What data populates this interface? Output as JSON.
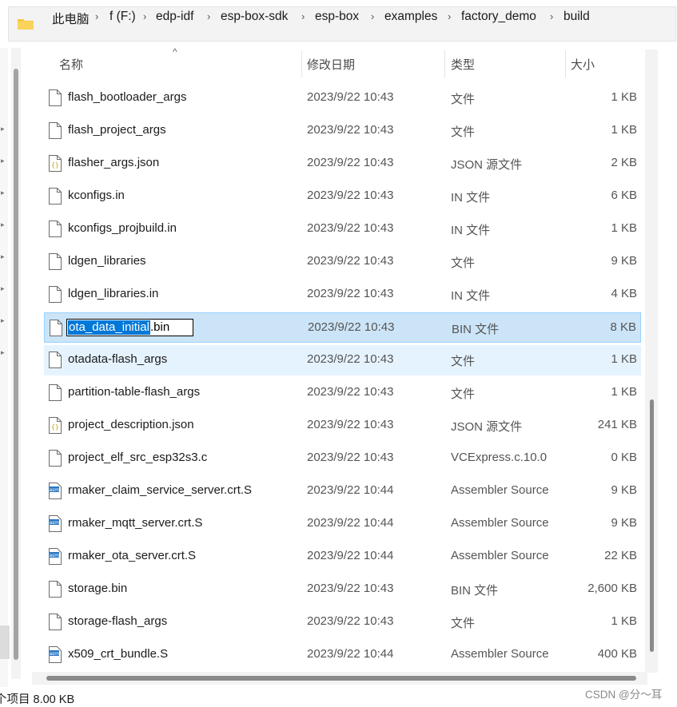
{
  "breadcrumb": {
    "items": [
      "此电脑",
      "f (F:)",
      "edp-idf",
      "esp-box-sdk",
      "esp-box",
      "examples",
      "factory_demo",
      "build"
    ]
  },
  "columns": {
    "name": "名称",
    "date": "修改日期",
    "type": "类型",
    "size": "大小"
  },
  "files": [
    {
      "name": "flash_bootloader_args",
      "date": "2023/9/22 10:43",
      "type": "文件",
      "size": "1 KB",
      "icon": "file-icon"
    },
    {
      "name": "flash_project_args",
      "date": "2023/9/22 10:43",
      "type": "文件",
      "size": "1 KB",
      "icon": "file-icon"
    },
    {
      "name": "flasher_args.json",
      "date": "2023/9/22 10:43",
      "type": "JSON 源文件",
      "size": "2 KB",
      "icon": "json-file-icon"
    },
    {
      "name": "kconfigs.in",
      "date": "2023/9/22 10:43",
      "type": "IN 文件",
      "size": "6 KB",
      "icon": "file-icon"
    },
    {
      "name": "kconfigs_projbuild.in",
      "date": "2023/9/22 10:43",
      "type": "IN 文件",
      "size": "1 KB",
      "icon": "file-icon"
    },
    {
      "name": "ldgen_libraries",
      "date": "2023/9/22 10:43",
      "type": "文件",
      "size": "9 KB",
      "icon": "file-icon"
    },
    {
      "name": "ldgen_libraries.in",
      "date": "2023/9/22 10:43",
      "type": "IN 文件",
      "size": "4 KB",
      "icon": "file-icon"
    },
    {
      "name": "ota_data_initial.bin",
      "date": "2023/9/22 10:43",
      "type": "BIN 文件",
      "size": "8 KB",
      "icon": "file-icon"
    },
    {
      "name": "otadata-flash_args",
      "date": "2023/9/22 10:43",
      "type": "文件",
      "size": "1 KB",
      "icon": "file-icon"
    },
    {
      "name": "partition-table-flash_args",
      "date": "2023/9/22 10:43",
      "type": "文件",
      "size": "1 KB",
      "icon": "file-icon"
    },
    {
      "name": "project_description.json",
      "date": "2023/9/22 10:43",
      "type": "JSON 源文件",
      "size": "241 KB",
      "icon": "json-file-icon"
    },
    {
      "name": "project_elf_src_esp32s3.c",
      "date": "2023/9/22 10:43",
      "type": "VCExpress.c.10.0",
      "size": "0 KB",
      "icon": "file-icon"
    },
    {
      "name": "rmaker_claim_service_server.crt.S",
      "date": "2023/9/22 10:44",
      "type": "Assembler Source",
      "size": "9 KB",
      "icon": "asm-file-icon"
    },
    {
      "name": "rmaker_mqtt_server.crt.S",
      "date": "2023/9/22 10:44",
      "type": "Assembler Source",
      "size": "9 KB",
      "icon": "asm-file-icon"
    },
    {
      "name": "rmaker_ota_server.crt.S",
      "date": "2023/9/22 10:44",
      "type": "Assembler Source",
      "size": "22 KB",
      "icon": "asm-file-icon"
    },
    {
      "name": "storage.bin",
      "date": "2023/9/22 10:43",
      "type": "BIN 文件",
      "size": "2,600 KB",
      "icon": "file-icon"
    },
    {
      "name": "storage-flash_args",
      "date": "2023/9/22 10:43",
      "type": "文件",
      "size": "1 KB",
      "icon": "file-icon"
    },
    {
      "name": "x509_crt_bundle.S",
      "date": "2023/9/22 10:44",
      "type": "Assembler Source",
      "size": "400 KB",
      "icon": "asm-file-icon"
    }
  ],
  "rename": {
    "selected_text": "ota_data_initial",
    "rest_text": ".bin"
  },
  "status": {
    "text": "个项目  8.00 KB"
  },
  "watermark": "CSDN @分～耳"
}
